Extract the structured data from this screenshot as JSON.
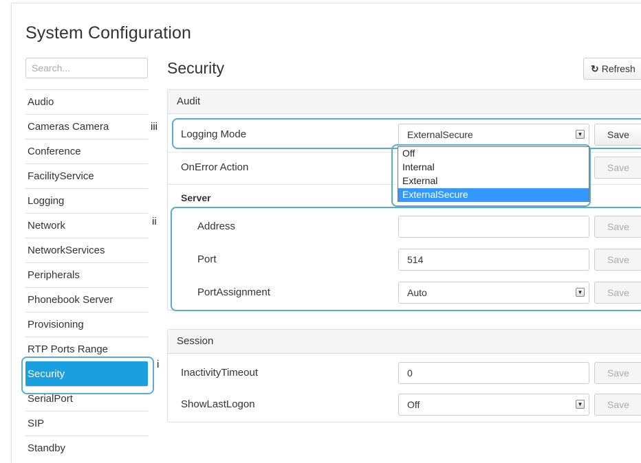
{
  "page": {
    "title": "System Configuration"
  },
  "search": {
    "placeholder": "Search..."
  },
  "sidebar": {
    "items": [
      {
        "label": "Audio"
      },
      {
        "label": "Cameras Camera"
      },
      {
        "label": "Conference"
      },
      {
        "label": "FacilityService"
      },
      {
        "label": "Logging"
      },
      {
        "label": "Network"
      },
      {
        "label": "NetworkServices"
      },
      {
        "label": "Peripherals"
      },
      {
        "label": "Phonebook Server"
      },
      {
        "label": "Provisioning"
      },
      {
        "label": "RTP Ports Range"
      },
      {
        "label": "Security",
        "active": true
      },
      {
        "label": "SerialPort"
      },
      {
        "label": "SIP"
      },
      {
        "label": "Standby"
      }
    ]
  },
  "main": {
    "title": "Security",
    "refresh_label": "Refresh",
    "refresh_icon": "refresh-icon"
  },
  "audit": {
    "heading": "Audit",
    "logging_mode": {
      "label": "Logging Mode",
      "value": "ExternalSecure",
      "save": "Save"
    },
    "onerror_action": {
      "label": "OnError Action",
      "save": "Save"
    },
    "dropdown_options": [
      "Off",
      "Internal",
      "External",
      "ExternalSecure"
    ],
    "dropdown_selected": "ExternalSecure",
    "server": {
      "heading": "Server",
      "address": {
        "label": "Address",
        "value": "",
        "save": "Save"
      },
      "port": {
        "label": "Port",
        "value": "514",
        "save": "Save"
      },
      "port_assignment": {
        "label": "PortAssignment",
        "value": "Auto",
        "save": "Save"
      }
    }
  },
  "session": {
    "heading": "Session",
    "inactivity_timeout": {
      "label": "InactivityTimeout",
      "value": "0",
      "save": "Save"
    },
    "show_last_logon": {
      "label": "ShowLastLogon",
      "value": "Off",
      "save": "Save"
    }
  },
  "annotations": {
    "i": "i",
    "ii": "ii",
    "iii": "iii"
  },
  "colors": {
    "accent": "#1a9fe0",
    "callout": "#5aaad8",
    "dropdown_highlight": "#3399ff"
  }
}
